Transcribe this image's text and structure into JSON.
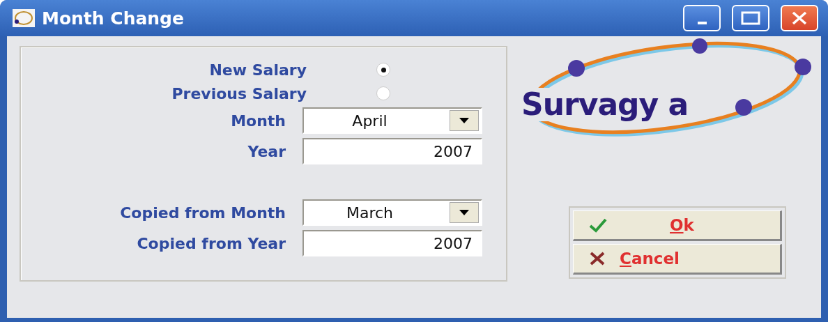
{
  "window": {
    "title": "Month Change"
  },
  "groups": [
    [
      {
        "kind": "radio",
        "label": "New Salary",
        "selected": true
      },
      {
        "kind": "radio",
        "label": "Previous Salary",
        "selected": false
      },
      {
        "kind": "dropdown",
        "label": "Month",
        "value": "April"
      },
      {
        "kind": "text",
        "label": "Year",
        "value": "2007"
      }
    ],
    [
      {
        "kind": "dropdown",
        "label": "Copied from Month",
        "value": "March"
      },
      {
        "kind": "text",
        "label": "Copied from Year",
        "value": "2007"
      }
    ]
  ],
  "logo": {
    "text": "Survagy a"
  },
  "buttons": [
    {
      "kind": "ok",
      "label": "Ok"
    },
    {
      "kind": "cancel",
      "label": "Cancel"
    }
  ]
}
